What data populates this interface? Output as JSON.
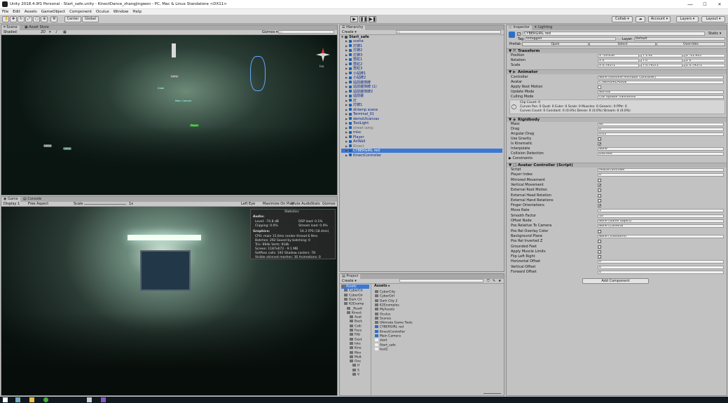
{
  "window": {
    "title": "Unity 2018.4.9f1 Personal - Start_safe.unity - KinectDance_zhangjingwen - PC, Mac & Linux Standalone <DX11>",
    "minimize": "—",
    "maximize": "☐",
    "close": "✕"
  },
  "menu": [
    "File",
    "Edit",
    "Assets",
    "GameObject",
    "Component",
    "Oculus",
    "Window",
    "Help"
  ],
  "toolbar": {
    "center": "Center",
    "global": "Global",
    "play": "▶",
    "pause": "❚❚",
    "step": "▶❚",
    "collab": "Collab ▾",
    "cloud": "☁",
    "account": "Account ▾",
    "layers": "Layers ▾",
    "layout": "Layout ▾"
  },
  "scene": {
    "tabs": [
      "Scene",
      "Asset Store"
    ],
    "shading": "Shaded",
    "mode": "2D",
    "gizmos": "Gizmos ▾",
    "search": "All",
    "persp": "Iso",
    "labels": [
      "Main Camera",
      "Cube",
      "Player",
      "Lamp",
      "Lamp",
      "Lamp"
    ]
  },
  "game": {
    "tabs": [
      "Game",
      "Console"
    ],
    "display": "Display 1",
    "aspect": "Free Aspect",
    "scale_label": "Scale",
    "scale_val": "1x",
    "eye": "Left Eye",
    "max": "Maximize On Play",
    "mute": "Mute Audio",
    "stats": "Stats",
    "gizmos": "Gizmos ▾"
  },
  "stats": {
    "title": "Statistics",
    "audio": "Audio:",
    "audio_l1": "Level: -74.8 dB",
    "audio_l1r": "DSP load: 0.1%",
    "audio_l2": "Clipping: 0.0%",
    "audio_l2r": "Stream load: 0.0%",
    "graphics": "Graphics:",
    "fps": "54.3 FPS (18.4ms)",
    "g1": "CPU: main 15.6ms  render thread 6.9ms",
    "g2": "Batches: 292    Saved by batching: 0",
    "g3": "Tris: 994k     Verts: 918k",
    "g4": "Screen: 1187x672 - 9.1 MB",
    "g5": "SetPass calls: 192   Shadow casters: 78",
    "g6": "Visible skinned meshes: 36  Animations: 0"
  },
  "hierarchy": {
    "tab": "Hierarchy",
    "create": "Create ▾",
    "search": "All",
    "root": "Start_safe",
    "items": [
      "scene",
      "灯牌1",
      "灯牌2",
      "灯牌3",
      "霓虹1",
      "霓虹2",
      "霓虹3",
      "小站牌1",
      "小站牌2",
      "站前装饰牌",
      "站前装饰牌 (1)",
      "站前装饰牌2",
      "站前装",
      "灯",
      "灯牌1",
      "dirlamp scene",
      "Terminal_01",
      "demoUIcanvas",
      "ToolLight",
      "street lamp",
      "misc",
      "Player",
      "AirWall",
      "Kinect",
      "CYBERGIRL red",
      "KinectController"
    ]
  },
  "project": {
    "tab": "Project",
    "create": "Create ▾",
    "root": "Assets",
    "breadcrumb": "Assets ▸",
    "tree": [
      "Assets",
      "CyberCit",
      "CyberGir",
      "Dark Cit",
      "K2Examp",
      "_Readi",
      "Kinect",
      "Avat",
      "Back",
      "Colli",
      "Face",
      "Fitti",
      "Gest",
      "Inte",
      "Kine",
      "Mov",
      "Mult",
      "Ove",
      "H",
      "S",
      "V"
    ],
    "files": [
      "CyberCity",
      "CyberGirl",
      "Dark City 2",
      "K2Examples",
      "MyAssets",
      "Oculus",
      "Scenes",
      "Ultimate Game Tools",
      "CYBERGIRL red",
      "KinectController",
      "Main Camera",
      "start",
      "Start_safe",
      "test2"
    ]
  },
  "inspector": {
    "tabs": [
      "Inspector",
      "Lighting"
    ],
    "name": "CYBERGIRL red",
    "static": "Static ▾",
    "tag_l": "Tag",
    "tag": "Untagged",
    "layer_l": "Layer",
    "layer": "Default",
    "prefab_l": "Prefab",
    "open": "Open",
    "select": "Select",
    "overrides": "Overrides",
    "transform": {
      "title": "Transform",
      "pos": "Position",
      "rot": "Rotation",
      "scl": "Scale",
      "px": "X -19.656",
      "py": "Y 1.41",
      "pz": "Z -11.915",
      "rx": "X 0",
      "ry": "Y 0",
      "rz": "Z 0",
      "sx": "X 0.79571",
      "sy": "Y 0.79571",
      "sz": "Z 0.79571"
    },
    "animator": {
      "title": "Animator",
      "rows": [
        [
          "Controller",
          "None (Runtime Animator Controller)"
        ],
        [
          "Avatar",
          "CYBERGIRLAvatar"
        ],
        [
          "Apply Root Motion",
          ""
        ],
        [
          "Update Mode",
          "Normal"
        ],
        [
          "Culling Mode",
          "Cull Update Transforms"
        ]
      ],
      "info1": "Clip Count: 0",
      "info2": "Curves Pos: 0 Quat: 0 Euler: 0 Scale: 0 Muscles: 0 Generic: 0 PPtr: 0",
      "info3": "Curves Count: 0 Constant: 0 (0.0%) Dense: 0 (0.0%) Stream: 0 (0.0%)"
    },
    "rigidbody": {
      "title": "Rigidbody",
      "rows": [
        [
          "Mass",
          "80"
        ],
        [
          "Drag",
          "0"
        ],
        [
          "Angular Drag",
          "0.05"
        ],
        [
          "Use Gravity",
          "☐"
        ],
        [
          "Is Kinematic",
          "✔"
        ],
        [
          "Interpolate",
          "None"
        ],
        [
          "Collision Detection",
          "Discrete"
        ]
      ],
      "constraints": "Constraints"
    },
    "avatar": {
      "title": "Avatar Controller (Script)",
      "rows": [
        [
          "Script",
          "AvatarController"
        ],
        [
          "Player Index",
          "0"
        ],
        [
          "Mirrored Movement",
          "☐"
        ],
        [
          "Vertical Movement",
          "✔"
        ],
        [
          "External Root Motion",
          "☐"
        ],
        [
          "External Head Rotation",
          "☐"
        ],
        [
          "External Hand Rotations",
          "☐"
        ],
        [
          "Finger Orientations",
          "✔"
        ],
        [
          "Move Rate",
          "1"
        ],
        [
          "Smooth Factor",
          "10"
        ],
        [
          "Offset Node",
          "None (Game Object)"
        ],
        [
          "Pos Relative To Camera",
          "None (Camera)"
        ],
        [
          "Pos Rel Overlay Color",
          "☐"
        ],
        [
          "Background Plane",
          "None (Transform)"
        ],
        [
          "Pos Rel Inverted Z",
          "☐"
        ],
        [
          "Grounded Feet",
          "☐"
        ],
        [
          "Apply Muscle Limits",
          "☐"
        ],
        [
          "Flip Left Right",
          "☐"
        ],
        [
          "Horizontal Offset",
          "0"
        ],
        [
          "Vertical Offset",
          "0"
        ],
        [
          "Forward Offset",
          "0"
        ]
      ]
    },
    "add_component": "Add Component"
  },
  "colors": {
    "accent": "#3b78d6",
    "panel": "#c2c2c2"
  }
}
